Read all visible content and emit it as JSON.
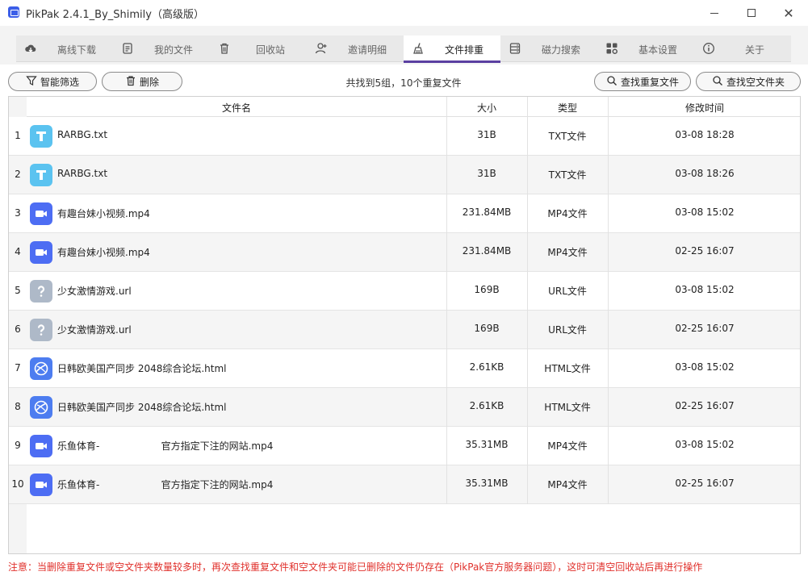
{
  "window": {
    "title": "PikPak 2.4.1_By_Shimily（高级版）"
  },
  "tabs": [
    {
      "label": "离线下载",
      "icon": "cloud-download-icon"
    },
    {
      "label": "我的文件",
      "icon": "document-icon"
    },
    {
      "label": "回收站",
      "icon": "trash-icon"
    },
    {
      "label": "邀请明细",
      "icon": "add-user-icon"
    },
    {
      "label": "文件排重",
      "icon": "broom-icon"
    },
    {
      "label": "磁力搜索",
      "icon": "database-icon"
    },
    {
      "label": "基本设置",
      "icon": "grid-settings-icon"
    },
    {
      "label": "关于",
      "icon": "info-icon"
    }
  ],
  "active_tab": 4,
  "toolbar": {
    "filter_label": "智能筛选",
    "delete_label": "删除",
    "status": "共找到5组，10个重复文件",
    "find_duplicates_label": "查找重复文件",
    "find_empty_folders_label": "查找空文件夹"
  },
  "table": {
    "columns": {
      "name": "文件名",
      "size": "大小",
      "type": "类型",
      "mtime": "修改时间"
    },
    "rows": [
      {
        "num": "1",
        "icon": "txt",
        "name": "RARBG.txt",
        "size": "31B",
        "type": "TXT文件",
        "mtime": "03-08 18:28"
      },
      {
        "num": "2",
        "icon": "txt",
        "name": "RARBG.txt",
        "size": "31B",
        "type": "TXT文件",
        "mtime": "03-08 18:26"
      },
      {
        "num": "3",
        "icon": "video",
        "name": "有趣台妹小视频.mp4",
        "size": "231.84MB",
        "type": "MP4文件",
        "mtime": "03-08 15:02"
      },
      {
        "num": "4",
        "icon": "video",
        "name": "有趣台妹小视频.mp4",
        "size": "231.84MB",
        "type": "MP4文件",
        "mtime": "02-25 16:07"
      },
      {
        "num": "5",
        "icon": "url",
        "name": "少女激情游戏.url",
        "size": "169B",
        "type": "URL文件",
        "mtime": "03-08 15:02"
      },
      {
        "num": "6",
        "icon": "url",
        "name": "少女激情游戏.url",
        "size": "169B",
        "type": "URL文件",
        "mtime": "02-25 16:07"
      },
      {
        "num": "7",
        "icon": "html",
        "name": "日韩欧美国产同步 2048综合论坛.html",
        "size": "2.61KB",
        "type": "HTML文件",
        "mtime": "03-08 15:02"
      },
      {
        "num": "8",
        "icon": "html",
        "name": "日韩欧美国产同步 2048综合论坛.html",
        "size": "2.61KB",
        "type": "HTML文件",
        "mtime": "02-25 16:07"
      },
      {
        "num": "9",
        "icon": "video",
        "name": "乐鱼体育-                    官方指定下注的网站.mp4",
        "size": "35.31MB",
        "type": "MP4文件",
        "mtime": "03-08 15:02"
      },
      {
        "num": "10",
        "icon": "video",
        "name": "乐鱼体育-                    官方指定下注的网站.mp4",
        "size": "35.31MB",
        "type": "MP4文件",
        "mtime": "02-25 16:07"
      }
    ]
  },
  "notice": "注意：当删除重复文件或空文件夹数量较多时，再次查找重复文件和空文件夹可能已删除的文件仍存在（PikPak官方服务器问题），这时可清空回收站后再进行操作",
  "colors": {
    "accent": "#5a3fa0",
    "notice": "#e0302b",
    "txt_icon": "#5bc3f0",
    "video_icon": "#4d6df3",
    "url_icon": "#aeb9c8",
    "html_icon": "#4d7df0"
  }
}
